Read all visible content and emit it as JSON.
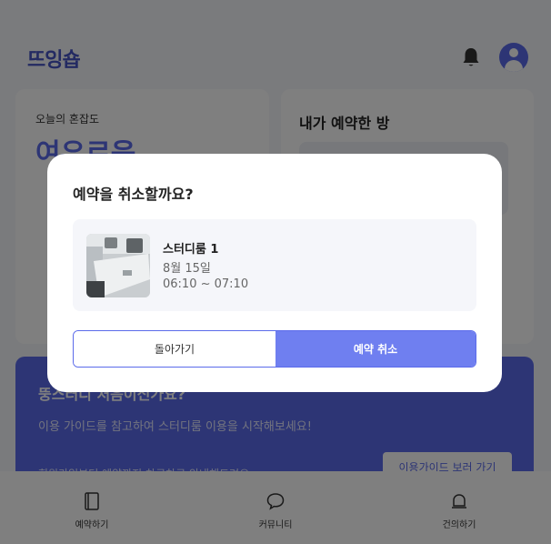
{
  "header": {
    "logo_text": "뜨잉숍"
  },
  "congestion": {
    "label": "오늘의 혼잡도",
    "value": "여유로움"
  },
  "reserved": {
    "title": "내가 예약한 방"
  },
  "banner": {
    "title": "뚱스터디 처음이신가요?",
    "subtitle": "이용 가이드를 참고하여 스터디룸 이용을 시작해보세요!",
    "note": "회원가입부터 예약까지 차근차근 안내해드려요",
    "button_label": "이용가이드 보러 가기"
  },
  "bottom_nav": {
    "items": [
      {
        "label": "예약하기",
        "icon": "book-icon"
      },
      {
        "label": "커뮤니티",
        "icon": "chat-bubble-icon"
      },
      {
        "label": "건의하기",
        "icon": "bell-icon"
      }
    ]
  },
  "modal": {
    "title": "예약을 취소할까요?",
    "room_name": "스터디룸 1",
    "date": "8월 15일",
    "time": "06:10 ~ 07:10",
    "back_label": "돌아가기",
    "cancel_label": "예약 취소"
  },
  "colors": {
    "accent": "#5b6bea",
    "cancel_button": "#6f7ff0",
    "room_box_bg": "#f5f6fa"
  }
}
